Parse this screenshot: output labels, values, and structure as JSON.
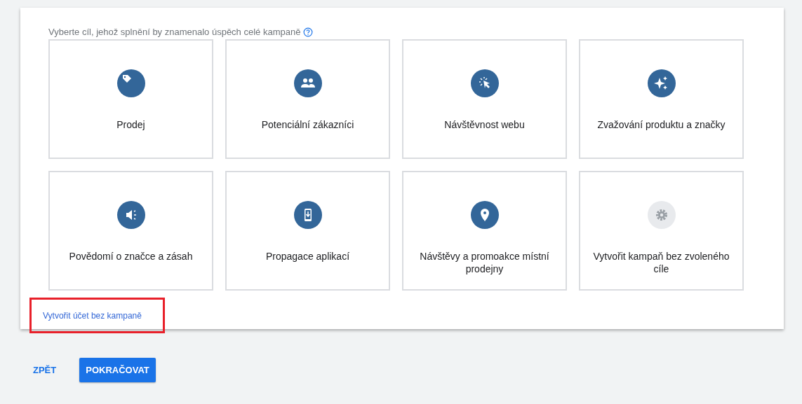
{
  "prompt": "Vyberte cíl, jehož splnění by znamenalo úspěch celé kampaně",
  "goals": [
    {
      "kind": "tag",
      "label": "Prodej",
      "dimmed": false
    },
    {
      "kind": "people",
      "label": "Potenciální zákazníci",
      "dimmed": false
    },
    {
      "kind": "cursor",
      "label": "Návštěvnost webu",
      "dimmed": false
    },
    {
      "kind": "sparkle",
      "label": "Zvažování produktu a značky",
      "dimmed": false
    },
    {
      "kind": "megaphone",
      "label": "Povědomí o značce a zásah",
      "dimmed": false
    },
    {
      "kind": "phone",
      "label": "Propagace aplikací",
      "dimmed": false
    },
    {
      "kind": "pin",
      "label": "Návštěvy a promoakce místní prodejny",
      "dimmed": false
    },
    {
      "kind": "gear",
      "label": "Vytvořit kampaň bez zvoleného cíle",
      "dimmed": true
    }
  ],
  "link": {
    "label": "Vytvořit účet bez kampaně",
    "highlighted": true
  },
  "buttons": [
    {
      "kind": "text",
      "label": "ZPĚT"
    },
    {
      "kind": "primary",
      "label": "POKRAČOVAT"
    }
  ]
}
